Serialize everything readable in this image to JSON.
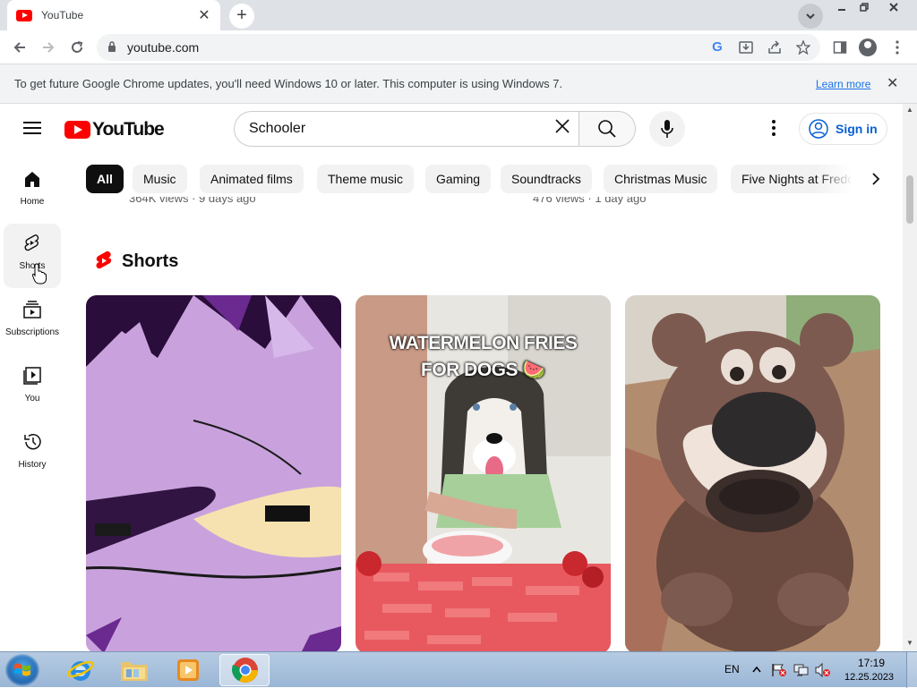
{
  "browser": {
    "tab_title": "YouTube",
    "tab_close": "✕",
    "new_tab": "+",
    "url": "youtube.com",
    "infobar": {
      "message": "To get future Google Chrome updates, you'll need Windows 10 or later. This computer is using Windows 7.",
      "learn_more": "Learn more",
      "close": "✕"
    }
  },
  "youtube": {
    "logo_text": "YouTube",
    "search": {
      "query": "Schooler",
      "clear": "✕"
    },
    "sign_in": "Sign in",
    "sidebar": [
      {
        "label": "Home"
      },
      {
        "label": "Shorts"
      },
      {
        "label": "Subscriptions"
      },
      {
        "label": "You"
      },
      {
        "label": "History"
      }
    ],
    "chips": [
      "All",
      "Music",
      "Animated films",
      "Theme music",
      "Gaming",
      "Soundtracks",
      "Christmas Music",
      "Five Nights at Freddy's"
    ],
    "above_fold_meta": [
      {
        "text": "364K views · 9 days ago"
      },
      {
        "text": "476 views · 1 day ago"
      }
    ],
    "shorts_title": "Shorts",
    "shorts": [
      {
        "caption": ""
      },
      {
        "caption_line1": "WATERMELON FRIES",
        "caption_line2": "FOR DOGS 🍉"
      },
      {
        "caption": ""
      }
    ]
  },
  "taskbar": {
    "language": "EN",
    "time": "17:19",
    "date": "12.25.2023"
  },
  "colors": {
    "brand_red": "#ff0000",
    "link_blue": "#065fd4",
    "chip_bg": "#f2f2f2",
    "chip_active_bg": "#0f0f0f"
  }
}
